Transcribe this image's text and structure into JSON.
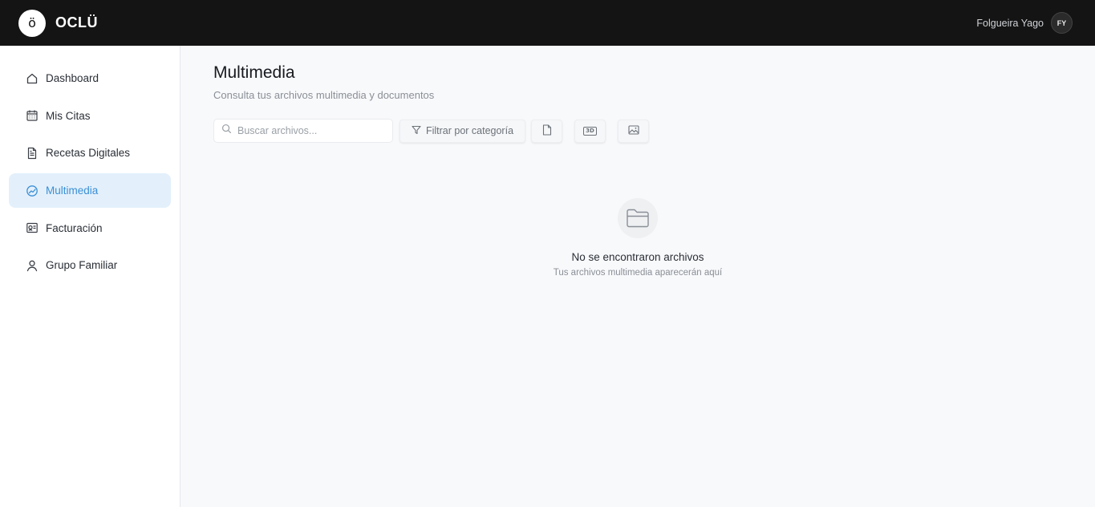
{
  "app": {
    "logo_glyph": "ö",
    "name": "OCLÜ"
  },
  "user": {
    "name": "Folgueira Yago",
    "initials": "FY"
  },
  "sidebar": {
    "items": [
      {
        "label": "Dashboard",
        "icon": "home-icon",
        "active": false
      },
      {
        "label": "Mis Citas",
        "icon": "calendar-icon",
        "active": false
      },
      {
        "label": "Recetas Digitales",
        "icon": "document-icon",
        "active": false
      },
      {
        "label": "Multimedia",
        "icon": "gauge-icon",
        "active": true
      },
      {
        "label": "Facturación",
        "icon": "billing-icon",
        "active": false
      },
      {
        "label": "Grupo Familiar",
        "icon": "user-icon",
        "active": false
      }
    ]
  },
  "main": {
    "title": "Multimedia",
    "subtitle": "Consulta tus archivos multimedia y documentos",
    "search": {
      "placeholder": "Buscar archivos...",
      "value": ""
    },
    "filter_label": "Filtrar por categoría",
    "type_buttons": [
      {
        "icon": "file-icon"
      },
      {
        "icon": "3d-icon",
        "text": "3D"
      },
      {
        "icon": "image-icon"
      }
    ],
    "empty": {
      "title": "No se encontraron archivos",
      "subtitle": "Tus archivos multimedia aparecerán aquí"
    }
  },
  "colors": {
    "topbar": "#141414",
    "accent": "#3b8fd6",
    "active_bg": "#e3f0fb"
  }
}
